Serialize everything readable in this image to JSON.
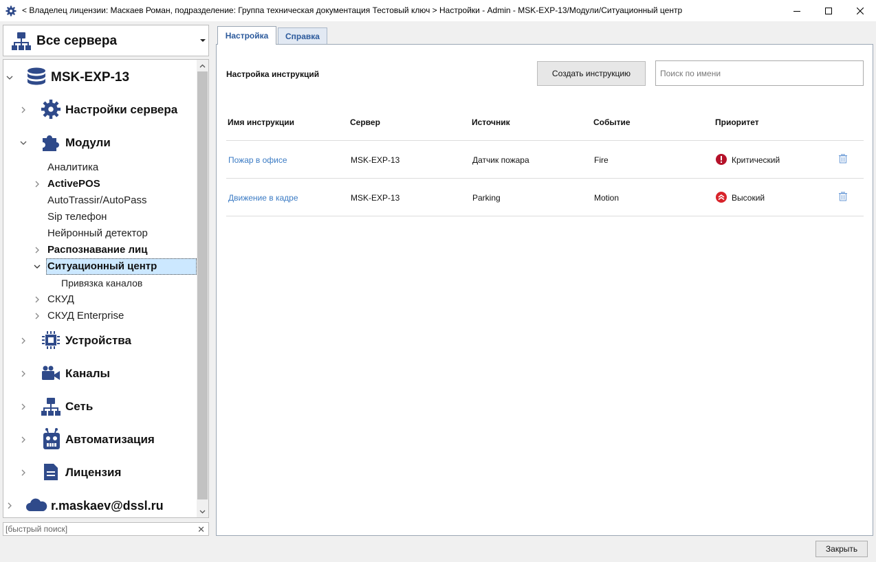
{
  "window": {
    "title": "< Владелец лицензии: Маскаев Роман, подразделение: Группа техническая документация Тестовый ключ > Настройки - Admin - MSK-EXP-13/Модули/Ситуационный центр"
  },
  "server_select": {
    "label": "Все сервера"
  },
  "tree": {
    "server": "MSK-EXP-13",
    "server_settings": "Настройки сервера",
    "modules": "Модули",
    "module_items": {
      "analytics": "Аналитика",
      "activepos": "ActivePOS",
      "autotrassir": "AutoTrassir/AutoPass",
      "sip": "Sip телефон",
      "neural": "Нейронный детектор",
      "face": "Распознавание лиц",
      "situation": "Ситуационный центр",
      "channel_binding": "Привязка каналов",
      "skud": "СКУД",
      "skud_enterprise": "СКУД Enterprise"
    },
    "devices": "Устройства",
    "channels": "Каналы",
    "network": "Сеть",
    "automation": "Автоматизация",
    "license": "Лицензия",
    "cloud_account": "r.maskaev@dssl.ru"
  },
  "quick_search": {
    "placeholder": "[быстрый поиск]"
  },
  "tabs": {
    "settings": "Настройка",
    "help": "Справка"
  },
  "panel": {
    "section_title": "Настройка инструкций",
    "create_button": "Создать инструкцию",
    "search_placeholder": "Поиск по имени"
  },
  "table": {
    "headers": {
      "name": "Имя инструкции",
      "server": "Сервер",
      "source": "Источник",
      "event": "Событие",
      "priority": "Приоритет"
    },
    "rows": [
      {
        "name": "Пожар в офисе",
        "server": "MSK-EXP-13",
        "source": "Датчик пожара",
        "event": "Fire",
        "priority": "Критический",
        "priority_icon": "exclamation-icon"
      },
      {
        "name": "Движение в кадре",
        "server": "MSK-EXP-13",
        "source": "Parking",
        "event": "Motion",
        "priority": "Высокий",
        "priority_icon": "chevrons-up-icon"
      }
    ]
  },
  "footer": {
    "close_button": "Закрыть"
  },
  "colors": {
    "accent": "#2c5a9c",
    "icon_blue": "#2f4a8a",
    "link": "#3b7bc4",
    "selection": "#cce8ff",
    "critical": "#b5122a",
    "high": "#d8232a"
  }
}
